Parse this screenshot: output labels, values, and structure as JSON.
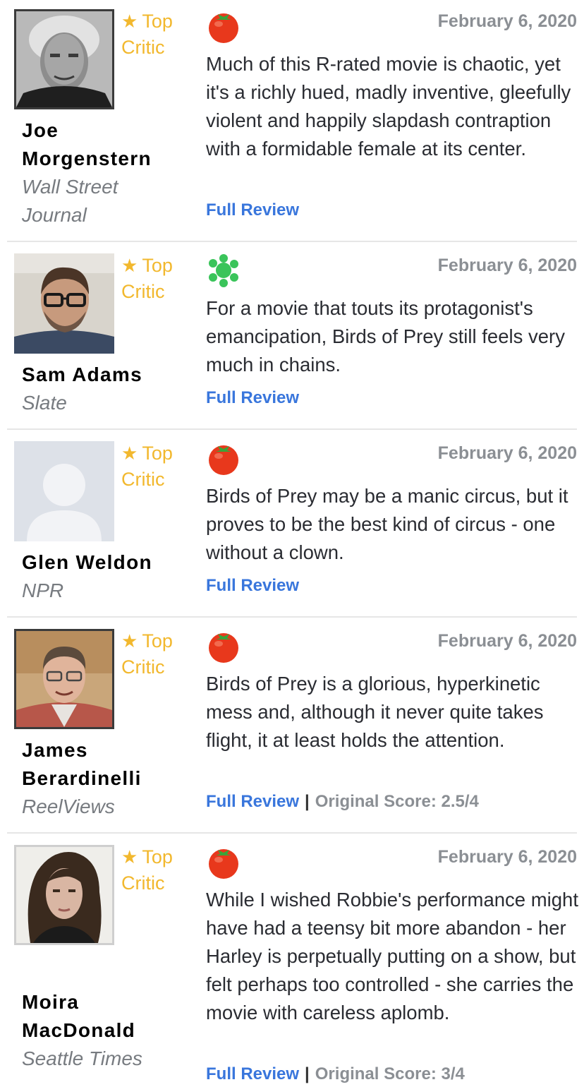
{
  "top_critic_label": "Top Critic",
  "colors": {
    "accent_gold": "#f2b82e",
    "link_blue": "#3976dc",
    "fresh_red": "#e8381c",
    "rotten_green": "#3ac45a",
    "muted_gray": "#8b8f94"
  },
  "reviews": [
    {
      "critic_name": "Joe Morgenstern",
      "publication": "Wall Street Journal",
      "top_critic": "Top Critic",
      "rating_icon": "fresh-tomato-icon",
      "date": "February 6, 2020",
      "quote": "Much of this R-rated movie is chaotic, yet it's a richly hued, madly inventive, gleefully violent and happily slapdash contraption with a formidable female at its center.",
      "full_review_label": "Full Review",
      "original_score": ""
    },
    {
      "critic_name": "Sam Adams",
      "publication": "Slate",
      "top_critic": "Top Critic",
      "rating_icon": "rotten-splat-icon",
      "date": "February 6, 2020",
      "quote": "For a movie that touts its protagonist's emancipation, Birds of Prey still feels very much in chains.",
      "full_review_label": "Full Review",
      "original_score": ""
    },
    {
      "critic_name": "Glen Weldon",
      "publication": "NPR",
      "top_critic": "Top Critic",
      "rating_icon": "fresh-tomato-icon",
      "date": "February 6, 2020",
      "quote": "Birds of Prey may be a manic circus, but it proves to be the best kind of circus - one without a clown.",
      "full_review_label": "Full Review",
      "original_score": ""
    },
    {
      "critic_name": "James Berardinelli",
      "publication": "ReelViews",
      "top_critic": "Top Critic",
      "rating_icon": "fresh-tomato-icon",
      "date": "February 6, 2020",
      "quote": "Birds of Prey is a glorious, hyperkinetic mess and, although it never quite takes flight, it at least holds the attention.",
      "full_review_label": "Full Review",
      "original_score": "Original Score: 2.5/4"
    },
    {
      "critic_name": "Moira MacDonald",
      "publication": "Seattle Times",
      "top_critic": "Top Critic",
      "rating_icon": "fresh-tomato-icon",
      "date": "February 6, 2020",
      "quote": "While I wished Robbie's performance might have had a teensy bit more abandon - her Harley is perpetually putting on a show, but felt perhaps too controlled - she carries the movie with careless aplomb.",
      "full_review_label": "Full Review",
      "original_score": "Original Score: 3/4"
    }
  ]
}
